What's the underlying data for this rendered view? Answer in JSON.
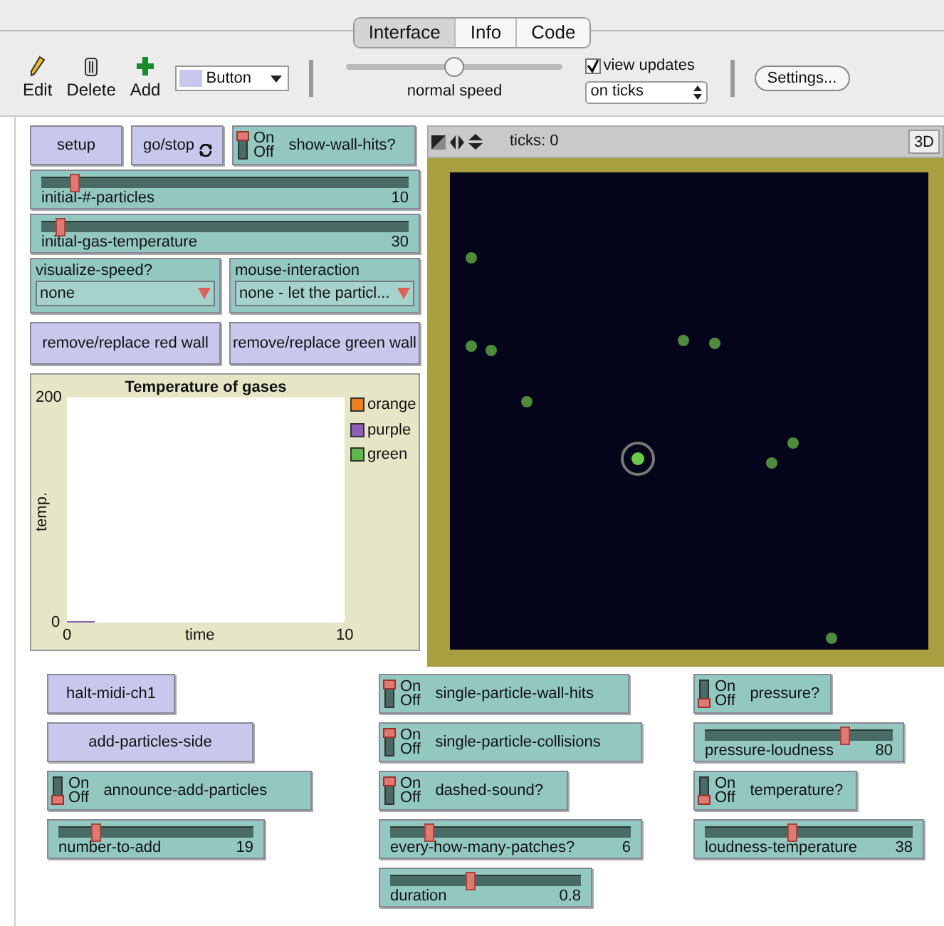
{
  "tabs": [
    {
      "label": "Interface",
      "selected": true
    },
    {
      "label": "Info",
      "selected": false
    },
    {
      "label": "Code",
      "selected": false
    }
  ],
  "toolbar": {
    "tools": [
      {
        "kind": "edit",
        "label": "Edit"
      },
      {
        "kind": "delete",
        "label": "Delete"
      },
      {
        "kind": "add",
        "label": "Add"
      }
    ],
    "widget_type": "Button",
    "speed": {
      "label": "normal speed",
      "level": 0.5
    },
    "view_updates": {
      "label": "view updates",
      "checked": true
    },
    "update_mode": "on ticks",
    "settings": "Settings..."
  },
  "left_widgets": [
    [
      {
        "kind": "button",
        "label": "setup",
        "forever": false
      },
      {
        "kind": "button",
        "label": "go/stop",
        "forever": true
      },
      {
        "kind": "switch",
        "label": "show-wall-hits?",
        "on_label": "On",
        "off_label": "Off",
        "on": true
      }
    ],
    [
      {
        "kind": "slider",
        "label": "initial-#-particles",
        "value": "10",
        "level": 0.09
      }
    ],
    [
      {
        "kind": "slider",
        "label": "initial-gas-temperature",
        "value": "30",
        "level": 0.05
      }
    ],
    [
      {
        "kind": "chooser",
        "label": "visualize-speed?",
        "value": "none"
      },
      {
        "kind": "chooser",
        "label": "mouse-interaction",
        "value": "none - let the particl..."
      }
    ],
    [
      {
        "kind": "button",
        "label": "remove/replace red wall",
        "forever": false
      },
      {
        "kind": "button",
        "label": "remove/replace green wall",
        "forever": false
      }
    ]
  ],
  "plot": {
    "chart_data": {
      "type": "line",
      "title": "Temperature of gases",
      "xlabel": "time",
      "ylabel": "temp.",
      "x": [
        0,
        1
      ],
      "xlim": [
        0,
        10
      ],
      "ylim": [
        0,
        200
      ],
      "xticks": [
        0,
        10
      ],
      "yticks": [
        0,
        200
      ],
      "series": [
        {
          "name": "orange",
          "color": "#f07d1e",
          "values": [
            null,
            null
          ]
        },
        {
          "name": "purple",
          "color": "#8d5fb8",
          "values": [
            0,
            0
          ]
        },
        {
          "name": "green",
          "color": "#5bb84a",
          "values": [
            null,
            null
          ]
        }
      ]
    }
  },
  "view": {
    "ticks": "ticks: 0",
    "three_d": "3D"
  },
  "columns": [
    [
      {
        "kind": "button",
        "label": "halt-midi-ch1",
        "forever": false
      },
      {
        "kind": "button",
        "label": "add-particles-side",
        "forever": false
      },
      {
        "kind": "switch",
        "label": "announce-add-particles",
        "on_label": "On",
        "off_label": "Off",
        "on": false
      },
      {
        "kind": "slider",
        "label": "number-to-add",
        "value": "19",
        "level": 0.19
      }
    ],
    [
      {
        "kind": "switch",
        "label": "single-particle-wall-hits",
        "on_label": "On",
        "off_label": "Off",
        "on": true
      },
      {
        "kind": "switch",
        "label": "single-particle-collisions",
        "on_label": "On",
        "off_label": "Off",
        "on": true
      },
      {
        "kind": "switch",
        "label": "dashed-sound?",
        "on_label": "On",
        "off_label": "Off",
        "on": true
      },
      {
        "kind": "slider",
        "label": "every-how-many-patches?",
        "value": "6",
        "level": 0.16
      },
      {
        "kind": "slider",
        "label": "duration",
        "value": "0.8",
        "level": 0.42
      }
    ],
    [
      {
        "kind": "switch",
        "label": "pressure?",
        "on_label": "On",
        "off_label": "Off",
        "on": false
      },
      {
        "kind": "slider",
        "label": "pressure-loudness",
        "value": "80",
        "level": 0.74
      },
      {
        "kind": "switch",
        "label": "temperature?",
        "on_label": "On",
        "off_label": "Off",
        "on": false
      },
      {
        "kind": "slider",
        "label": "loudness-temperature",
        "value": "38",
        "level": 0.42
      }
    ]
  ]
}
